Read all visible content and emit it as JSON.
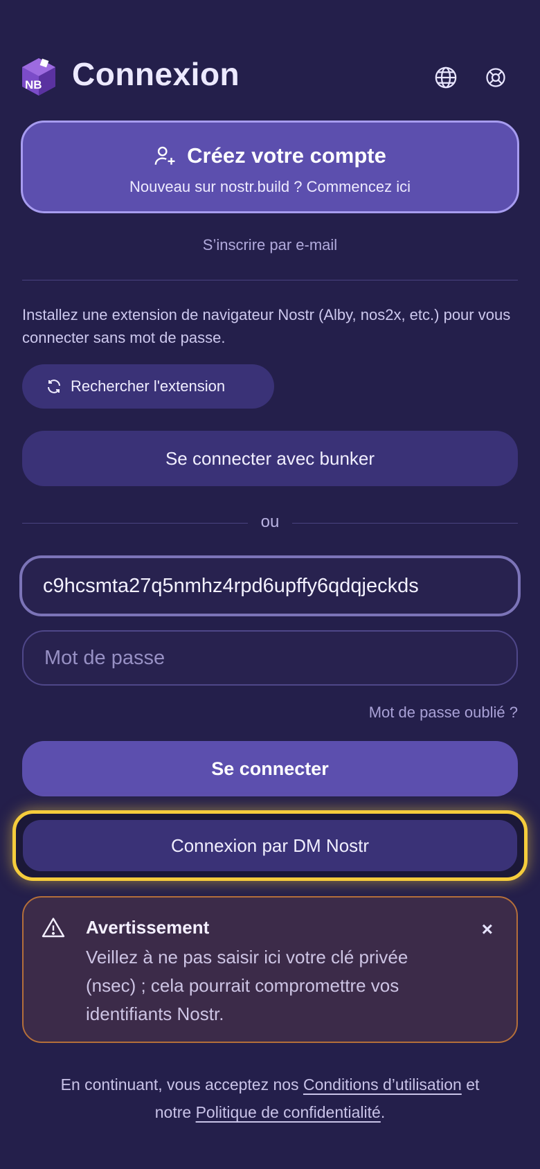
{
  "header": {
    "title": "Connexion",
    "logo_text": "NB",
    "icons": [
      "globe-icon",
      "lifebuoy-icon"
    ]
  },
  "create_account": {
    "title": "Créez votre compte",
    "subtitle": "Nouveau sur nostr.build ? Commencez ici",
    "icon": "user-plus-icon"
  },
  "email_signup": "S’inscrire par e-mail",
  "extension": {
    "text": "Installez une extension de navigateur Nostr (Alby, nos2x, etc.) pour vous connecter sans mot de passe.",
    "search_label": "Rechercher l'extension",
    "icon": "refresh-icon"
  },
  "bunker_label": "Se connecter avec bunker",
  "or_label": "ou",
  "form": {
    "identifier_value": "c9hcsmta27q5nmhz4rpd6upffy6qdqjeckds",
    "password_placeholder": "Mot de passe",
    "forgot_label": "Mot de passe oublié ?",
    "login_label": "Se connecter",
    "dm_login_label": "Connexion par DM Nostr"
  },
  "warning": {
    "title": "Avertissement",
    "text": "Veillez à ne pas saisir ici votre clé privée (nsec) ; cela pourrait compromettre vos identifiants Nostr.",
    "close_label": "×",
    "icon": "warning-triangle-icon"
  },
  "footer": {
    "prefix": "En continuant, vous acceptez nos ",
    "terms_link": "Conditions d’utilisation",
    "middle": " et notre ",
    "privacy_link": "Politique de confidentialité",
    "suffix": "."
  },
  "colors": {
    "background": "#241f4b",
    "primary": "#5c4fae",
    "secondary_button": "#3a3277",
    "highlight": "#f5cc3c",
    "warning_border": "#b46f3a"
  }
}
